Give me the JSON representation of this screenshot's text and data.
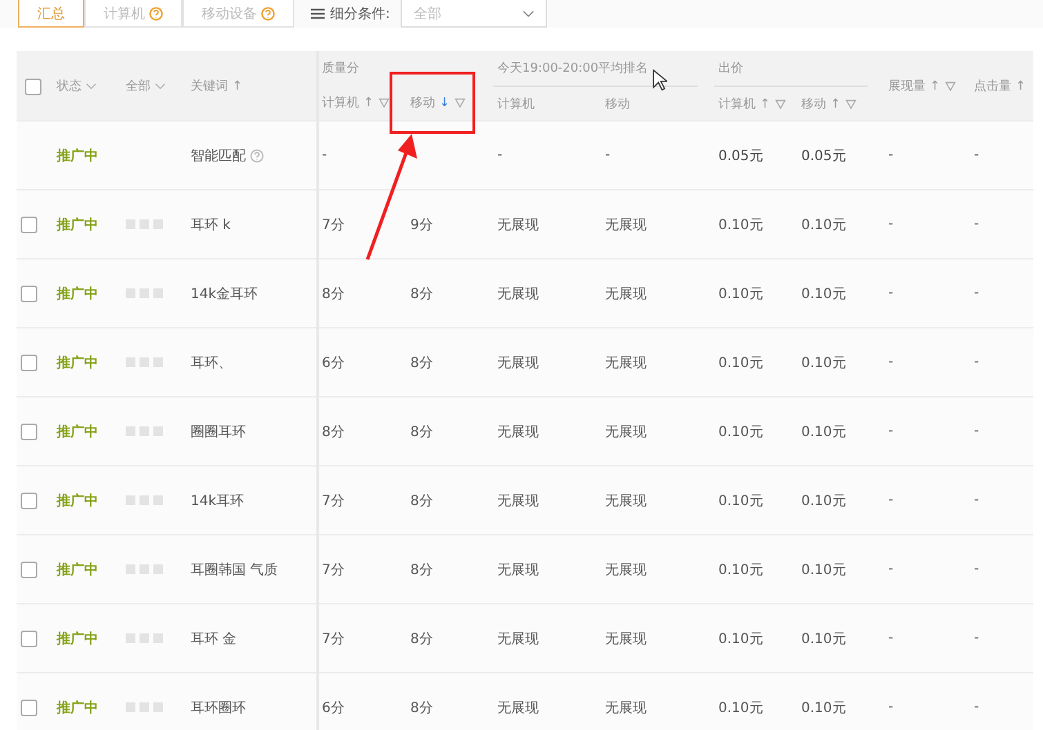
{
  "toolbar": {
    "tabs": [
      {
        "label": "汇总",
        "selected": true,
        "help": false
      },
      {
        "label": "计算机",
        "selected": false,
        "help": true
      },
      {
        "label": "移动设备",
        "selected": false,
        "help": true
      }
    ],
    "filter": {
      "label": "细分条件:",
      "value": "全部"
    }
  },
  "header": {
    "select_all_checked": false,
    "status": "状态",
    "all": "全部",
    "keyword": "关键词",
    "keyword_sort": "↑",
    "groups": [
      {
        "label": "质量分",
        "underline": false,
        "columns": [
          {
            "label": "计算机",
            "sort": "↑",
            "sort_active": false,
            "filter": true
          },
          {
            "label": "移动",
            "sort": "↓",
            "sort_active": true,
            "filter": true
          }
        ]
      },
      {
        "label": "今天19:00-20:00平均排名",
        "underline": true,
        "columns": [
          {
            "label": "计算机",
            "filter": false
          },
          {
            "label": "移动",
            "filter": false
          }
        ]
      },
      {
        "label": "出价",
        "underline": true,
        "columns": [
          {
            "label": "计算机",
            "sort": "↑",
            "sort_active": false,
            "filter": true
          },
          {
            "label": "移动",
            "sort": "↑",
            "sort_active": false,
            "filter": true
          }
        ]
      }
    ],
    "extra": [
      {
        "label": "展现量",
        "sort": "↑",
        "filter": true
      },
      {
        "label": "点击量",
        "sort": "↑",
        "filter": false
      }
    ]
  },
  "rows": [
    {
      "kind": "smart",
      "status": "推广中",
      "keyword": "智能匹配",
      "values": [
        "-",
        "-",
        "-",
        "0.05元",
        "0.05元",
        "-",
        "-"
      ]
    },
    {
      "kind": "keyword",
      "checked": false,
      "status": "推广中",
      "keyword": "耳环 k",
      "values": [
        "7分",
        "9分",
        "无展现",
        "无展现",
        "0.10元",
        "0.10元",
        "-",
        "-"
      ]
    },
    {
      "kind": "keyword",
      "checked": false,
      "status": "推广中",
      "keyword": "14k金耳环",
      "values": [
        "8分",
        "8分",
        "无展现",
        "无展现",
        "0.10元",
        "0.10元",
        "-",
        "-"
      ]
    },
    {
      "kind": "keyword",
      "checked": false,
      "status": "推广中",
      "keyword": "耳环、",
      "values": [
        "6分",
        "8分",
        "无展现",
        "无展现",
        "0.10元",
        "0.10元",
        "-",
        "-"
      ]
    },
    {
      "kind": "keyword",
      "checked": false,
      "status": "推广中",
      "keyword": "圈圈耳环",
      "values": [
        "8分",
        "8分",
        "无展现",
        "无展现",
        "0.10元",
        "0.10元",
        "-",
        "-"
      ]
    },
    {
      "kind": "keyword",
      "checked": false,
      "status": "推广中",
      "keyword": "14k耳环",
      "values": [
        "7分",
        "8分",
        "无展现",
        "无展现",
        "0.10元",
        "0.10元",
        "-",
        "-"
      ]
    },
    {
      "kind": "keyword",
      "checked": false,
      "status": "推广中",
      "keyword": "耳圈韩国 气质",
      "values": [
        "7分",
        "8分",
        "无展现",
        "无展现",
        "0.10元",
        "0.10元",
        "-",
        "-"
      ]
    },
    {
      "kind": "keyword",
      "checked": false,
      "status": "推广中",
      "keyword": "耳环 金",
      "values": [
        "7分",
        "8分",
        "无展现",
        "无展现",
        "0.10元",
        "0.10元",
        "-",
        "-"
      ]
    },
    {
      "kind": "keyword",
      "checked": false,
      "status": "推广中",
      "keyword": "耳环圈环",
      "values": [
        "6分",
        "8分",
        "无展现",
        "无展现",
        "0.10元",
        "0.10元",
        "-",
        "-"
      ]
    }
  ]
}
